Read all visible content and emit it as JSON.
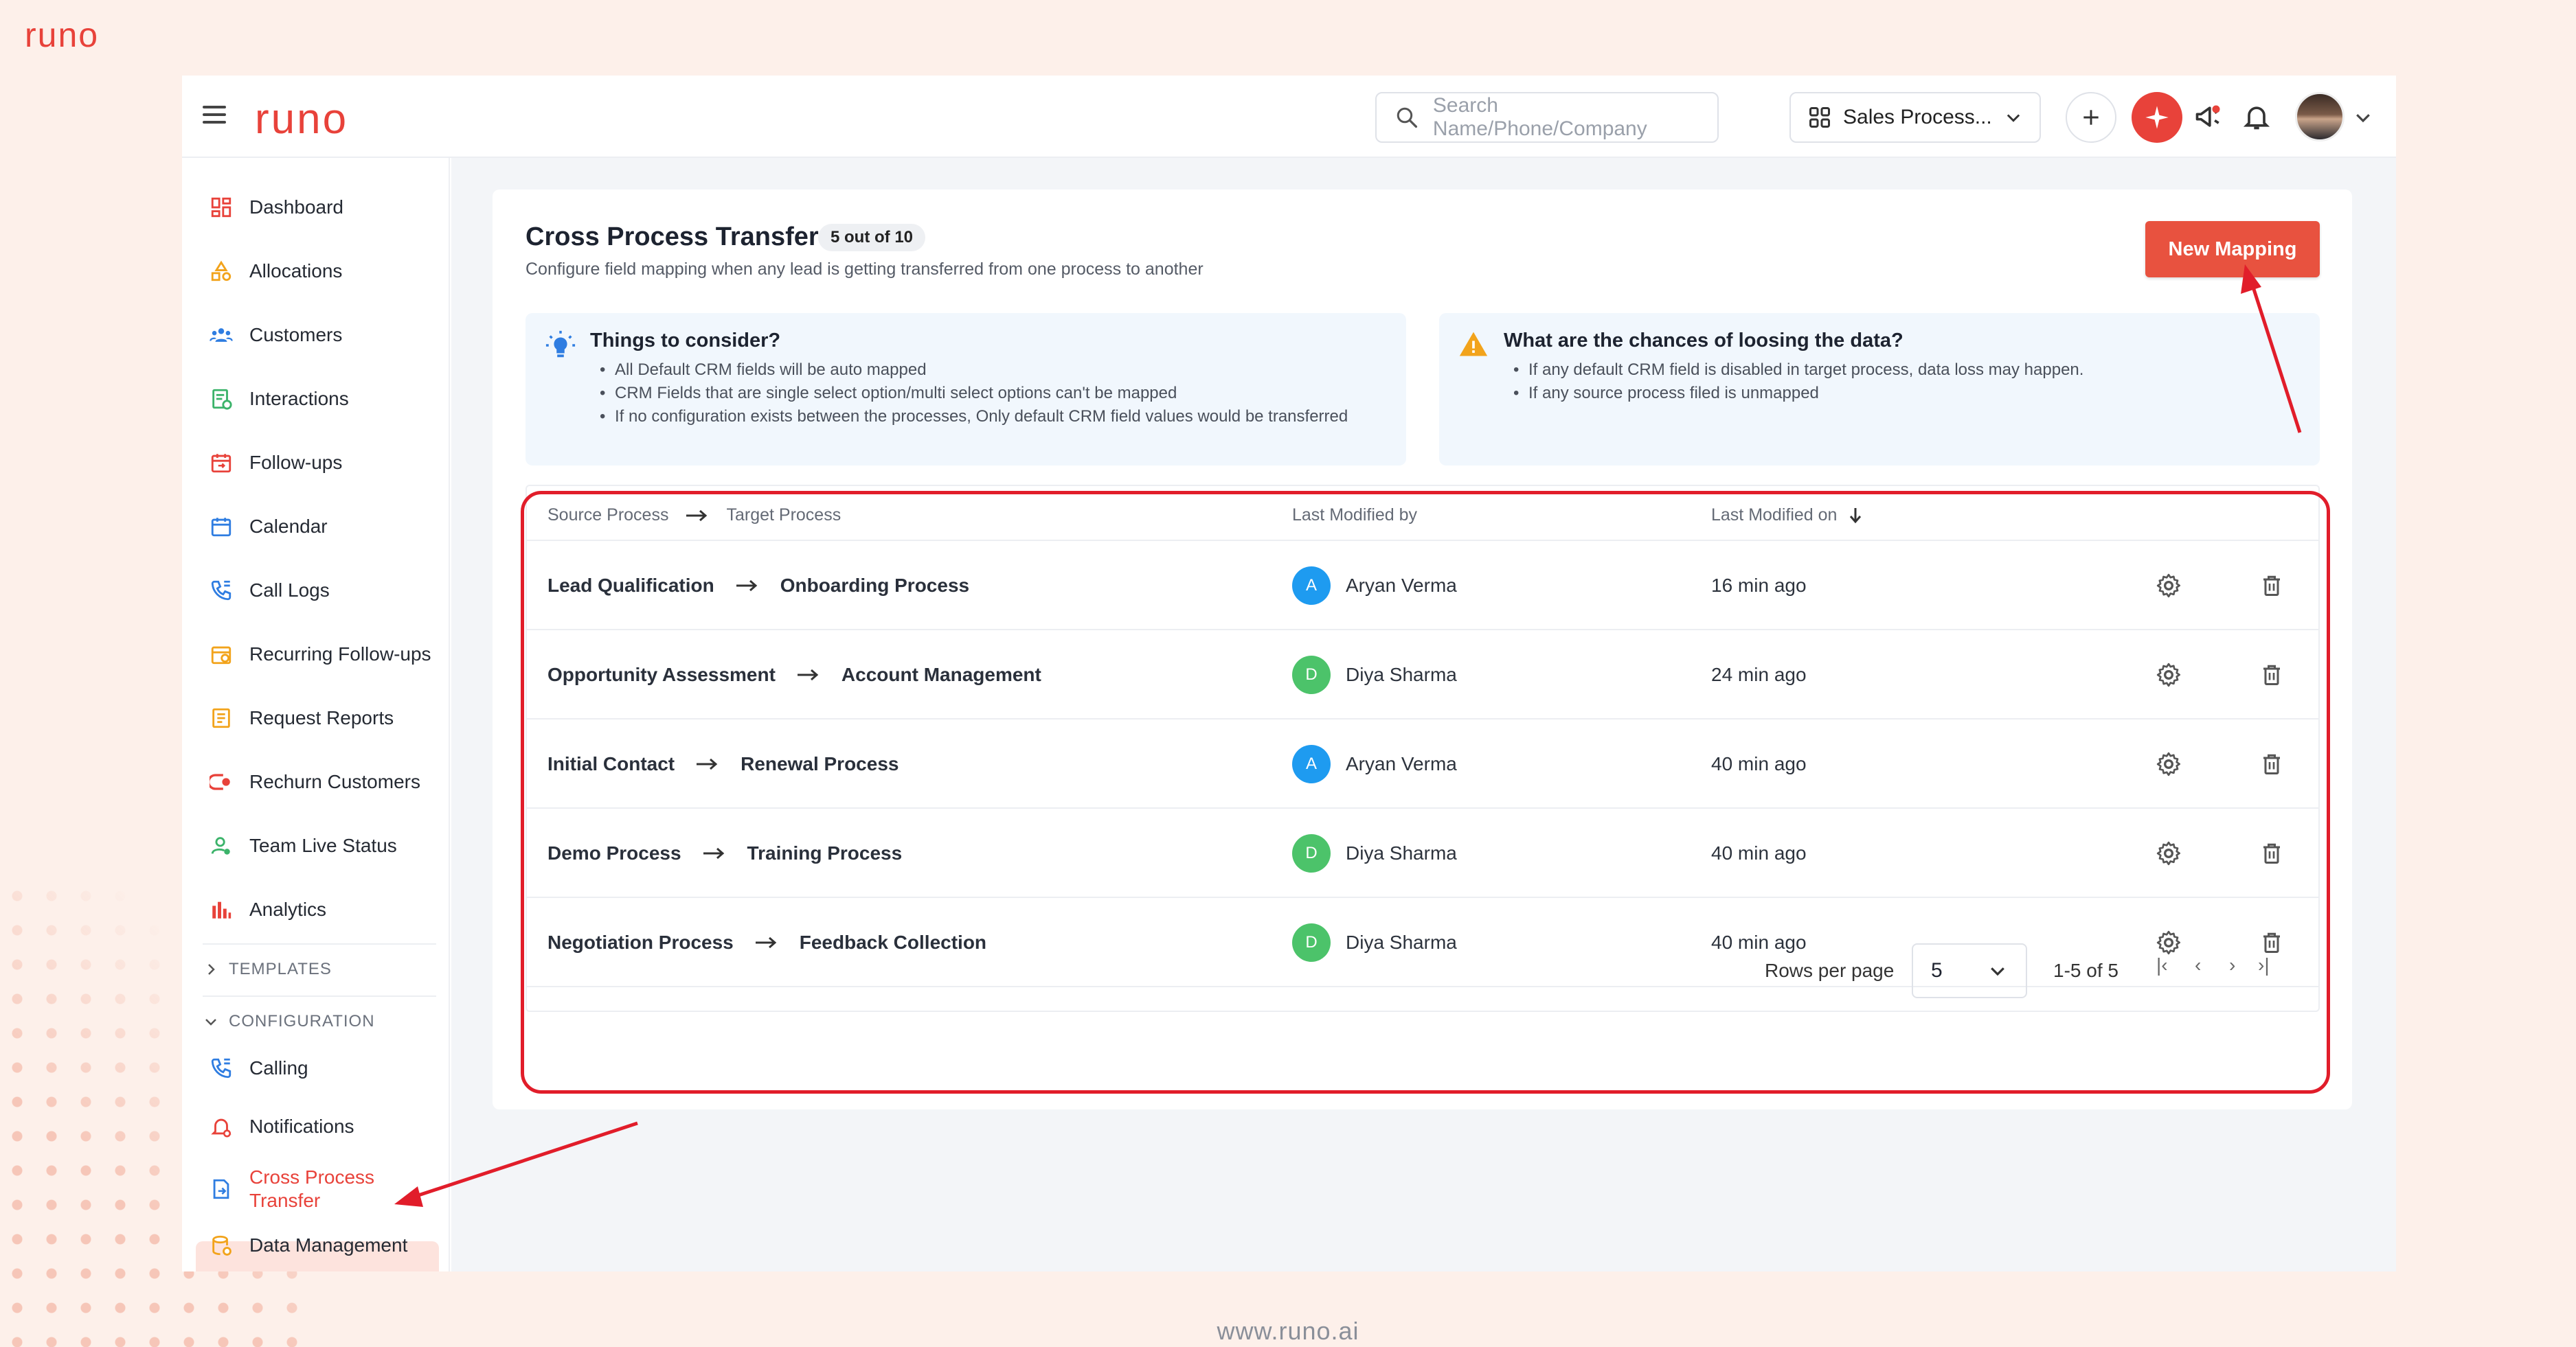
{
  "brand": {
    "outer_logo": "runo",
    "app_logo": "runo",
    "footer": "www.runo.ai"
  },
  "topbar": {
    "search_placeholder": "Search Name/Phone/Company",
    "process_selector": "Sales Process...",
    "icons": [
      "menu-icon",
      "search-icon",
      "grid-icon",
      "chevron-down-icon",
      "plus-icon",
      "sparkle-icon",
      "megaphone-icon",
      "bell-icon",
      "avatar",
      "chevron-down-icon"
    ]
  },
  "sidebar": {
    "items": [
      {
        "label": "Dashboard",
        "icon": "dashboard-icon"
      },
      {
        "label": "Allocations",
        "icon": "allocations-icon"
      },
      {
        "label": "Customers",
        "icon": "customers-icon"
      },
      {
        "label": "Interactions",
        "icon": "interactions-icon"
      },
      {
        "label": "Follow-ups",
        "icon": "followups-icon"
      },
      {
        "label": "Calendar",
        "icon": "calendar-icon"
      },
      {
        "label": "Call Logs",
        "icon": "call-logs-icon"
      },
      {
        "label": "Recurring Follow-ups",
        "icon": "recurring-icon"
      },
      {
        "label": "Request Reports",
        "icon": "reports-icon"
      },
      {
        "label": "Rechurn Customers",
        "icon": "rechurn-icon"
      },
      {
        "label": "Team Live Status",
        "icon": "team-status-icon"
      },
      {
        "label": "Analytics",
        "icon": "analytics-icon"
      }
    ],
    "sections": {
      "templates": "TEMPLATES",
      "configuration": "CONFIGURATION"
    },
    "config_items": [
      {
        "label": "Calling",
        "icon": "calling-icon"
      },
      {
        "label": "Notifications",
        "icon": "notifications-icon"
      },
      {
        "label": "Cross Process",
        "label2": "Transfer",
        "icon": "transfer-icon"
      },
      {
        "label": "Data Management",
        "icon": "data-icon"
      }
    ]
  },
  "page": {
    "title": "Cross Process Transfer",
    "badge": "5 out of 10",
    "subtitle": "Configure field mapping when any lead is getting transferred from one process to another",
    "new_button": "New Mapping"
  },
  "info_cards": [
    {
      "title": "Things to consider?",
      "icon": "lightbulb-icon",
      "points": [
        "All Default CRM fields will be auto mapped",
        "CRM Fields that are single select option/multi select options can't be mapped",
        "If no configuration exists between the processes, Only default CRM field values would be transferred"
      ]
    },
    {
      "title": "What are the chances of loosing the data?",
      "icon": "warning-icon",
      "points": [
        "If any default CRM field is disabled in target process, data loss may happen.",
        "If any source process filed is unmapped"
      ]
    }
  ],
  "table": {
    "headers": {
      "source": "Source Process",
      "target": "Target Process",
      "modified_by": "Last Modified by",
      "modified_on": "Last Modified on"
    },
    "rows": [
      {
        "source": "Lead Qualification",
        "target": "Onboarding Process",
        "initial": "A",
        "user": "Aryan Verma",
        "time": "16 min ago"
      },
      {
        "source": "Opportunity Assessment",
        "target": "Account Management",
        "initial": "D",
        "user": "Diya Sharma",
        "time": "24 min ago"
      },
      {
        "source": "Initial Contact",
        "target": "Renewal Process",
        "initial": "A",
        "user": "Aryan Verma",
        "time": "40 min ago"
      },
      {
        "source": "Demo Process",
        "target": "Training Process",
        "initial": "D",
        "user": "Diya Sharma",
        "time": "40 min ago"
      },
      {
        "source": "Negotiation Process",
        "target": "Feedback Collection",
        "initial": "D",
        "user": "Diya Sharma",
        "time": "40 min ago"
      }
    ],
    "pagination": {
      "rows_label": "Rows per page",
      "rows_value": "5",
      "range": "1-5 of 5",
      "first": "|‹",
      "prev": "‹",
      "next": "›",
      "last": "›|"
    }
  },
  "colors": {
    "accent": "#e8423a",
    "avatar_a": "#1e9bf0",
    "avatar_d": "#4cc36a",
    "highlight": "#e11d2a"
  }
}
